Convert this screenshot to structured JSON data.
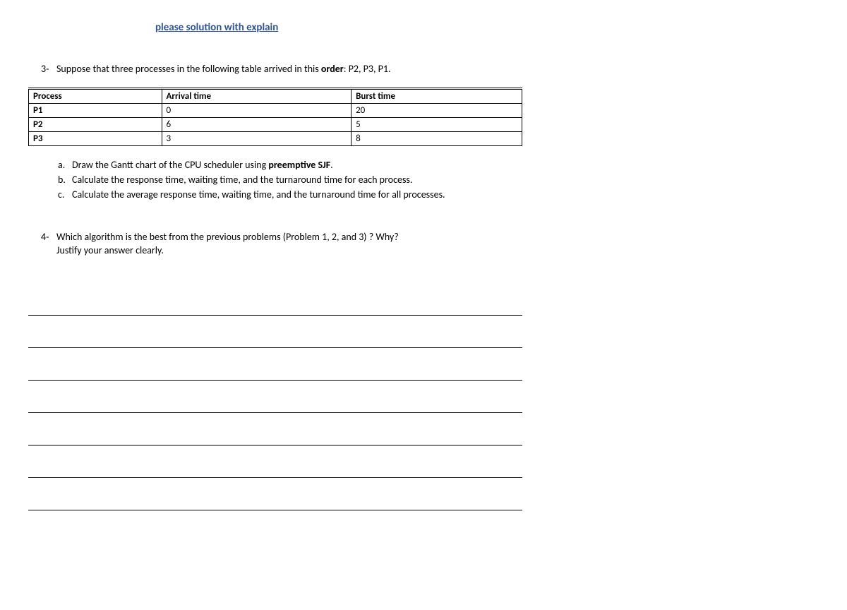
{
  "title": "please solution with explain",
  "q3": {
    "marker": "3-",
    "text_before": "Suppose that three processes in the following table arrived in this ",
    "bold_word": "order",
    "text_after": ": P2, P3, P1."
  },
  "table": {
    "headers": [
      "Process",
      "Arrival time",
      "Burst time"
    ],
    "rows": [
      [
        "P1",
        "0",
        "20"
      ],
      [
        "P2",
        "6",
        "5"
      ],
      [
        "P3",
        "3",
        "8"
      ]
    ]
  },
  "subs": {
    "a": {
      "m": "a.",
      "before": "Draw the Gantt chart of the CPU scheduler using ",
      "bold": "preemptive SJF",
      "after": "."
    },
    "b": {
      "m": "b.",
      "text": "Calculate the response time, waiting time, and the turnaround time for each process."
    },
    "c": {
      "m": "c.",
      "text": "Calculate the average response time, waiting time, and the turnaround time for all processes."
    }
  },
  "q4": {
    "marker": "4-",
    "line1": "Which algorithm is the best from the previous problems (Problem 1, 2, and 3) ? Why?",
    "line2": "Justify your answer clearly."
  }
}
